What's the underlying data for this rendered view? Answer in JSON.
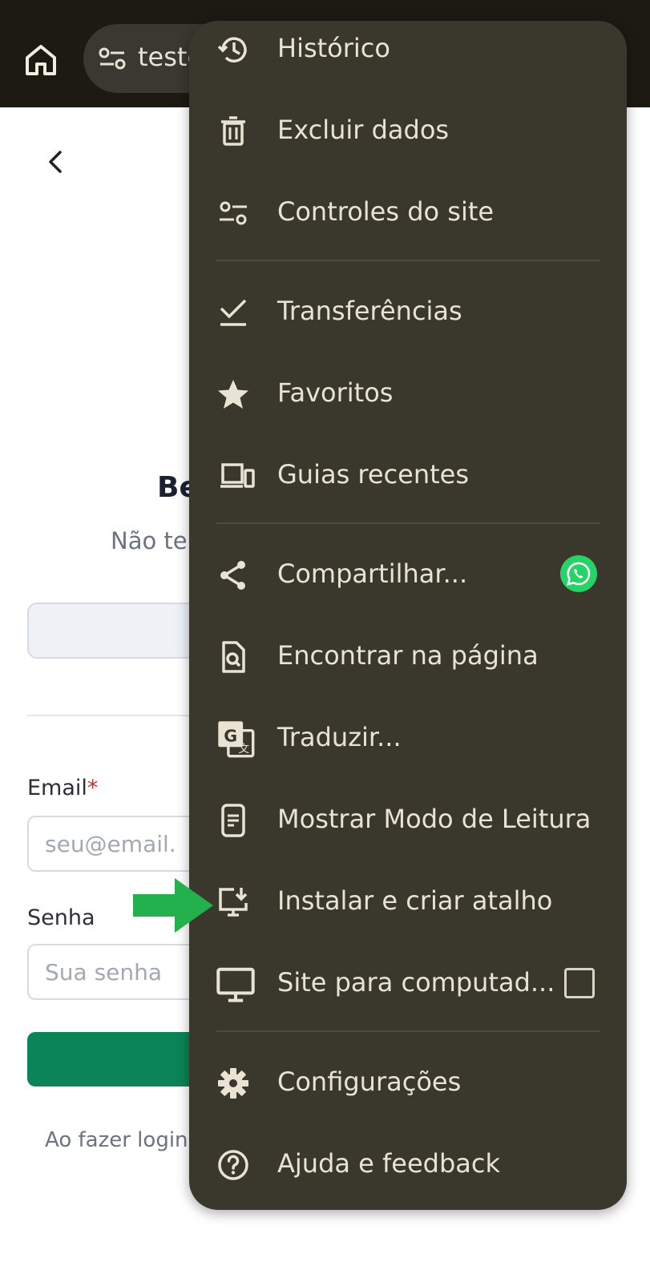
{
  "browser": {
    "address_text": "teste"
  },
  "page": {
    "heading_partial": "Be",
    "subtitle_partial": "Não te",
    "email_label": "Email",
    "email_required_mark": "*",
    "email_placeholder": "seu@email.",
    "password_label": "Senha",
    "password_placeholder": "Sua senha",
    "terms_partial": "Ao fazer login"
  },
  "menu": {
    "items": [
      {
        "label": "Histórico",
        "icon": "history-icon"
      },
      {
        "label": "Excluir dados",
        "icon": "trash-icon"
      },
      {
        "label": "Controles do site",
        "icon": "tune-icon"
      },
      {
        "label": "Transferências",
        "icon": "download-check-icon"
      },
      {
        "label": "Favoritos",
        "icon": "star-icon"
      },
      {
        "label": "Guias recentes",
        "icon": "devices-icon"
      },
      {
        "label": "Compartilhar...",
        "icon": "share-icon"
      },
      {
        "label": "Encontrar na página",
        "icon": "find-in-page-icon"
      },
      {
        "label": "Traduzir...",
        "icon": "translate-icon"
      },
      {
        "label": "Mostrar Modo de Leitura",
        "icon": "reader-mode-icon"
      },
      {
        "label": "Instalar e criar atalho",
        "icon": "install-app-icon"
      },
      {
        "label": "Site para computad...",
        "icon": "desktop-icon"
      },
      {
        "label": "Configurações",
        "icon": "gear-icon"
      },
      {
        "label": "Ajuda e feedback",
        "icon": "help-icon"
      }
    ],
    "desktop_site_checked": false
  },
  "colors": {
    "menu_bg": "#3a372d",
    "menu_text": "#e9e3d4",
    "top_bar": "#1d1a14",
    "whatsapp": "#25d366",
    "annotation_arrow": "#22b14c",
    "login_button": "#0b8457"
  }
}
